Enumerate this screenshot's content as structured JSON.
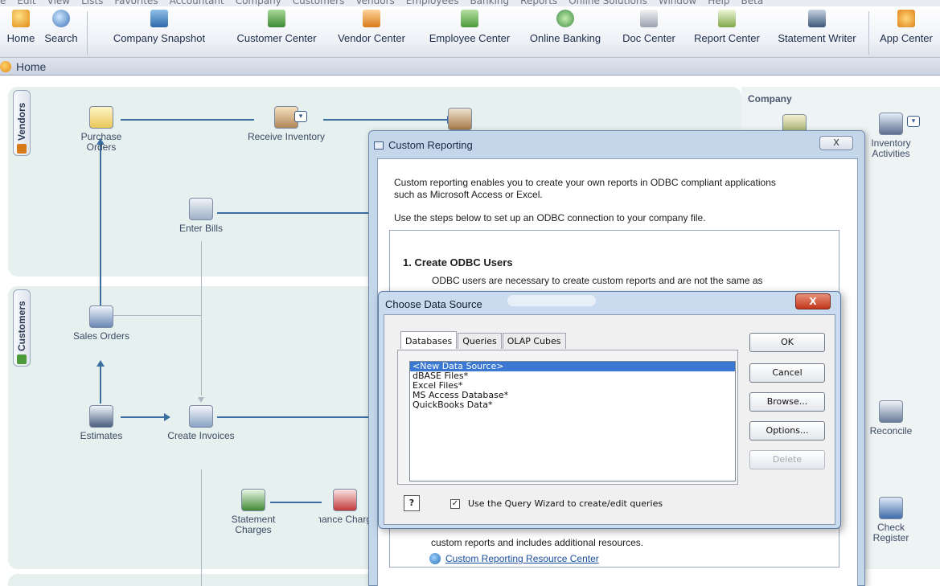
{
  "menu": [
    "e",
    "Edit",
    "View",
    "Lists",
    "Favorites",
    "Accountant",
    "Company",
    "Customers",
    "Vendors",
    "Employees",
    "Banking",
    "Reports",
    "Online Solutions",
    "Window",
    "Help",
    "Beta"
  ],
  "toolbar": {
    "home": "Home",
    "search": "Search",
    "company_snapshot": "Company Snapshot",
    "customer_center": "Customer Center",
    "vendor_center": "Vendor Center",
    "employee_center": "Employee Center",
    "online_banking": "Online Banking",
    "doc_center": "Doc Center",
    "report_center": "Report Center",
    "statement_writer": "Statement Writer",
    "app_center": "App Center"
  },
  "home_tab": "Home",
  "sections": {
    "vendors": "Vendors",
    "customers": "Customers",
    "company": "Company"
  },
  "workflow": {
    "purchase_orders": "Purchase Orders",
    "receive_inventory": "Receive Inventory",
    "enter_bills": "Enter Bills",
    "sales_orders": "Sales Orders",
    "estimates": "Estimates",
    "create_invoices": "Create Invoices",
    "statement_charges": "Statement Charges",
    "finance_charges": "Finance Charges",
    "inventory_activities": "Inventory Activities",
    "reconcile": "Reconcile",
    "check_register": "Check Register"
  },
  "custom_reporting": {
    "title": "Custom Reporting",
    "close": "X",
    "intro": "Custom reporting enables you to create your own reports in ODBC compliant applications such as Microsoft Access or Excel.",
    "steps_intro": "Use the steps below to set up an ODBC connection to your company file.",
    "step1_title": "1.   Create ODBC Users",
    "step1_text": "ODBC users are necessary to create custom reports and are not the same as",
    "footer_text": "custom reports and includes additional resources.",
    "link": "Custom Reporting Resource Center"
  },
  "choose_data_source": {
    "title": "Choose Data Source",
    "close": "X",
    "tabs": [
      "Databases",
      "Queries",
      "OLAP Cubes"
    ],
    "items": [
      "<New Data Source>",
      "dBASE Files*",
      "Excel Files*",
      "MS Access Database*",
      "QuickBooks Data*"
    ],
    "selected_index": 0,
    "buttons": {
      "ok": "OK",
      "cancel": "Cancel",
      "browse": "Browse...",
      "options": "Options...",
      "delete": "Delete"
    },
    "help": "?",
    "query_wizard_checked": true,
    "query_wizard_label": "Use the Query Wizard to create/edit queries"
  },
  "colors": {
    "accent": "#3a6ea0",
    "selection": "#3b78d1",
    "panel_bg": "#e6f0ee",
    "dialog_frame": "#c9dbef"
  }
}
